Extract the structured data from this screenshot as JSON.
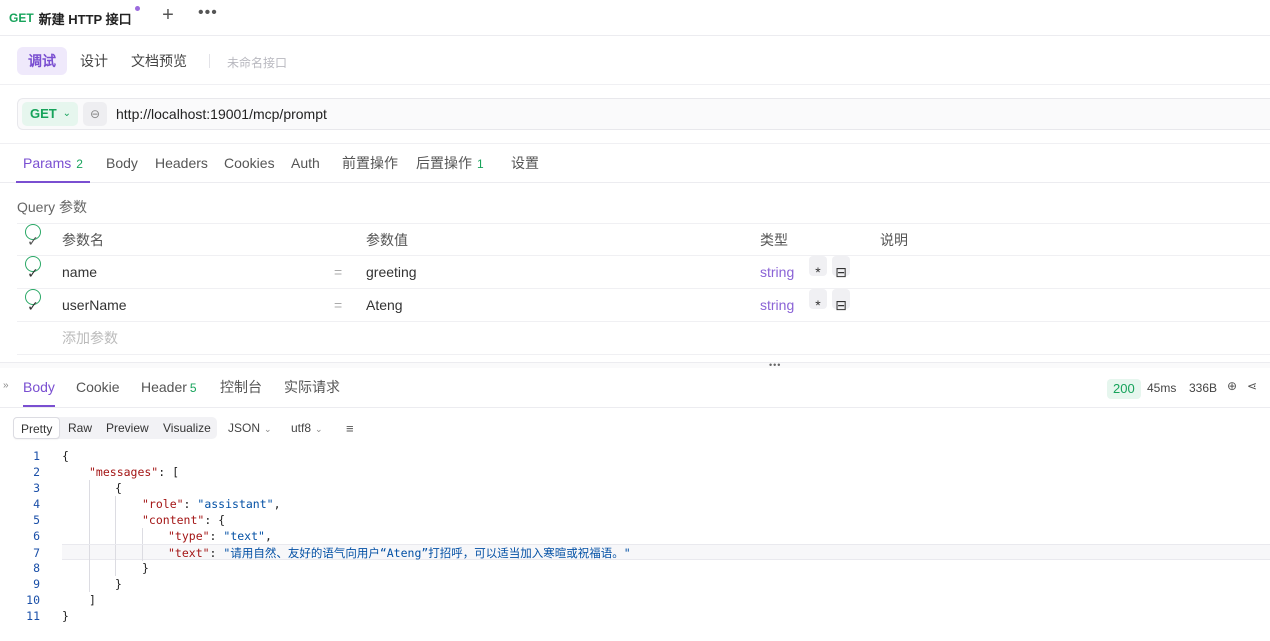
{
  "tab": {
    "method": "GET",
    "title": "新建 HTTP 接口"
  },
  "modes": {
    "debug": "调试",
    "design": "设计",
    "docs": "文档预览",
    "unnamed": "未命名接口"
  },
  "request": {
    "method": "GET",
    "chevron": "⌄",
    "link_icon": "link-icon",
    "url": "http://localhost:19001/mcp/prompt"
  },
  "req_tabs": {
    "params": "Params",
    "params_count": "2",
    "body": "Body",
    "headers": "Headers",
    "cookies": "Cookies",
    "auth": "Auth",
    "pre": "前置操作",
    "post": "后置操作",
    "post_count": "1",
    "settings": "设置"
  },
  "query": {
    "title": "Query 参数",
    "headers": {
      "name": "参数名",
      "value": "参数值",
      "type": "类型",
      "desc": "说明"
    },
    "rows": [
      {
        "name": "name",
        "eq": "=",
        "value": "greeting",
        "type": "string",
        "req": "*"
      },
      {
        "name": "userName",
        "eq": "=",
        "value": "Ateng",
        "type": "string",
        "req": "*"
      }
    ],
    "add": "添加参数"
  },
  "response": {
    "tabs": {
      "body": "Body",
      "cookie": "Cookie",
      "header": "Header",
      "header_count": "5",
      "console": "控制台",
      "actual": "实际请求"
    },
    "status": "200",
    "time": "45ms",
    "size": "336B"
  },
  "format": {
    "pretty": "Pretty",
    "raw": "Raw",
    "preview": "Preview",
    "visualize": "Visualize",
    "lang": "JSON",
    "encoding": "utf8"
  },
  "code": {
    "lines": [
      "1",
      "2",
      "3",
      "4",
      "5",
      "6",
      "7",
      "8",
      "9",
      "10",
      "11"
    ],
    "k_messages": "\"messages\"",
    "k_role": "\"role\"",
    "v_role": "\"assistant\"",
    "k_content": "\"content\"",
    "k_type": "\"type\"",
    "v_type": "\"text\"",
    "k_text": "\"text\"",
    "v_text": "\"请用自然、友好的语气向用户“Ateng”打招呼，可以适当加入寒暄或祝福语。\""
  },
  "colors": {
    "accent": "#7a4fd1",
    "get": "#17a35b",
    "string_type": "#8a63d6"
  }
}
